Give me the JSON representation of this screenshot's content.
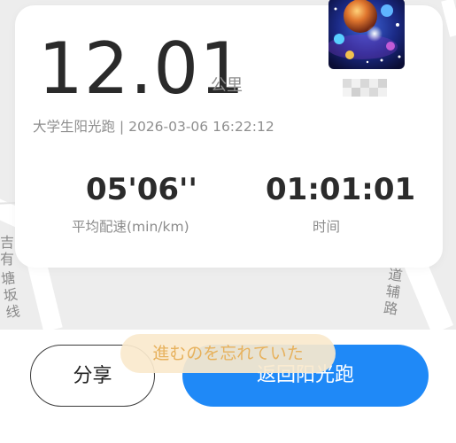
{
  "map": {
    "label_left_top": "吉有",
    "label_left_bottom": "塘坂线",
    "label_right": "道辅路"
  },
  "summary": {
    "distance_value": "12.01",
    "distance_unit": "公里",
    "subtitle": "大学生阳光跑 | 2026-03-06 16:22:12",
    "avatar_icon": "galaxy-avatar",
    "username_state": "blurred",
    "pace_value": "05'06''",
    "pace_label": "平均配速(min/km)",
    "time_value": "01:01:01",
    "time_label": "时间"
  },
  "toast": {
    "text": "進むのを忘れていた"
  },
  "actions": {
    "share_label": "分享",
    "back_label": "返回阳光跑",
    "primary_color": "#1f89f7"
  }
}
